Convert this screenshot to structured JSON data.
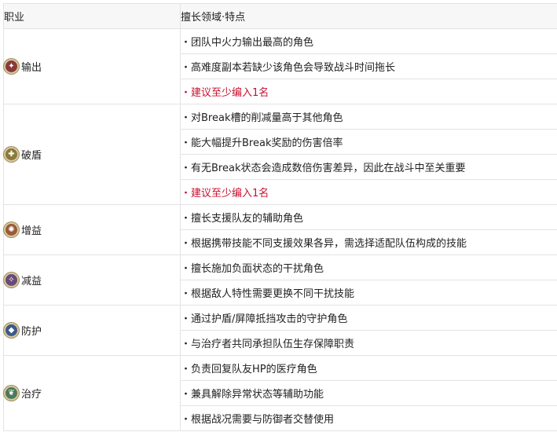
{
  "header": {
    "role_col": "职业",
    "spec_col": "擅长领域·特点"
  },
  "roles": [
    {
      "name": "输出",
      "icon": "damage-icon",
      "icon_glyph": "✦",
      "icon_color": "#8a3a3a",
      "items": [
        {
          "text": "团队中火力输出最高的角色",
          "highlight": false
        },
        {
          "text": "高难度副本若缺少该角色会导致战斗时间拖长",
          "highlight": false
        },
        {
          "text": "建议至少编入1名",
          "highlight": true
        }
      ]
    },
    {
      "name": "破盾",
      "icon": "break-icon",
      "icon_glyph": "✚",
      "icon_color": "#8a7a3a",
      "items": [
        {
          "text": "对Break槽的削减量高于其他角色",
          "highlight": false
        },
        {
          "text": "能大幅提升Break奖励的伤害倍率",
          "highlight": false
        },
        {
          "text": "有无Break状态会造成数倍伤害差异，因此在战斗中至关重要",
          "highlight": false
        },
        {
          "text": "建议至少编入1名",
          "highlight": true
        }
      ]
    },
    {
      "name": "增益",
      "icon": "buff-icon",
      "icon_glyph": "✺",
      "icon_color": "#9a5a3a",
      "items": [
        {
          "text": "擅长支援队友的辅助角色",
          "highlight": false
        },
        {
          "text": "根据携带技能不同支援效果各异，需选择适配队伍构成的技能",
          "highlight": false
        }
      ]
    },
    {
      "name": "减益",
      "icon": "debuff-icon",
      "icon_glyph": "✧",
      "icon_color": "#6a4a7a",
      "items": [
        {
          "text": "擅长施加负面状态的干扰角色",
          "highlight": false
        },
        {
          "text": "根据敌人特性需要更换不同干扰技能",
          "highlight": false
        }
      ]
    },
    {
      "name": "防护",
      "icon": "shield-icon",
      "icon_glyph": "◆",
      "icon_color": "#3a5a8a",
      "items": [
        {
          "text": "通过护盾/屏障抵挡攻击的守护角色",
          "highlight": false
        },
        {
          "text": "与治疗者共同承担队伍生存保障职责",
          "highlight": false
        }
      ]
    },
    {
      "name": "治疗",
      "icon": "heal-icon",
      "icon_glyph": "❦",
      "icon_color": "#4a7a5a",
      "items": [
        {
          "text": "负责回复队友HP的医疗角色",
          "highlight": false
        },
        {
          "text": "兼具解除异常状态等辅助功能",
          "highlight": false
        },
        {
          "text": "根据战况需要与防御者交替使用",
          "highlight": false
        }
      ]
    }
  ]
}
